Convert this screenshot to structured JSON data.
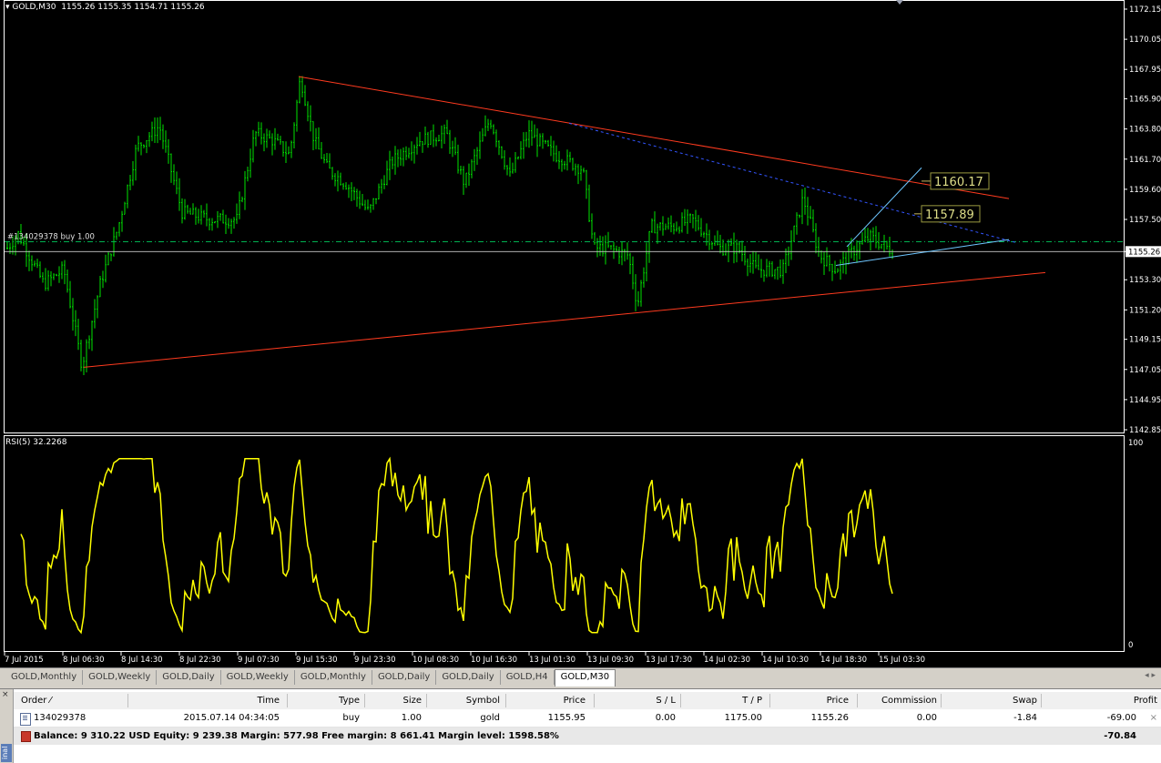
{
  "chart": {
    "header": "GOLD,M30  1155.26 1155.35 1154.71 1155.26",
    "current_price": "1155.26",
    "order_label": "#134029378 buy 1.00",
    "price_ticks": [
      "1172.15",
      "1170.05",
      "1167.95",
      "1165.90",
      "1163.80",
      "1161.70",
      "1159.60",
      "1157.50",
      "1155.26",
      "1153.30",
      "1151.20",
      "1149.15",
      "1147.05",
      "1144.95",
      "1142.85"
    ],
    "fib_labels": [
      "1160.17",
      "1157.89"
    ],
    "time_ticks": [
      "7 Jul 2015",
      "8 Jul 06:30",
      "8 Jul 14:30",
      "8 Jul 22:30",
      "9 Jul 07:30",
      "9 Jul 15:30",
      "9 Jul 23:30",
      "10 Jul 08:30",
      "10 Jul 16:30",
      "13 Jul 01:30",
      "13 Jul 09:30",
      "13 Jul 17:30",
      "14 Jul 02:30",
      "14 Jul 10:30",
      "14 Jul 18:30",
      "15 Jul 03:30"
    ],
    "colors": {
      "candle": "#00e400",
      "trendline": "#ff3b1f",
      "rsi": "#ffff00",
      "dashed": "#3355ff",
      "channel": "#6ec6ff",
      "order_line": "#00b050"
    }
  },
  "rsi": {
    "header": "RSI(5) 32.2268",
    "scale_top": "100",
    "scale_bottom": "0"
  },
  "tabs": [
    "GOLD,Monthly",
    "GOLD,Weekly",
    "GOLD,Daily",
    "GOLD,Weekly",
    "GOLD,Monthly",
    "GOLD,Daily",
    "GOLD,Daily",
    "GOLD,H4",
    "GOLD,M30"
  ],
  "active_tab": "GOLD,M30",
  "terminal": {
    "columns": [
      "Order",
      "Time",
      "Type",
      "Size",
      "Symbol",
      "Price",
      "S / L",
      "T / P",
      "Price",
      "Commission",
      "Swap",
      "Profit"
    ],
    "order": {
      "order": "134029378",
      "time": "2015.07.14 04:34:05",
      "type": "buy",
      "size": "1.00",
      "symbol": "gold",
      "price": "1155.95",
      "sl": "0.00",
      "tp": "1175.00",
      "cur_price": "1155.26",
      "commission": "0.00",
      "swap": "-1.84",
      "profit": "-69.00"
    },
    "balance_line": "Balance: 9 310.22 USD  Equity: 9 239.38  Margin: 577.98  Free margin: 8 661.41  Margin level: 1598.58%",
    "balance_profit": "-70.84",
    "side_label": "inal"
  }
}
